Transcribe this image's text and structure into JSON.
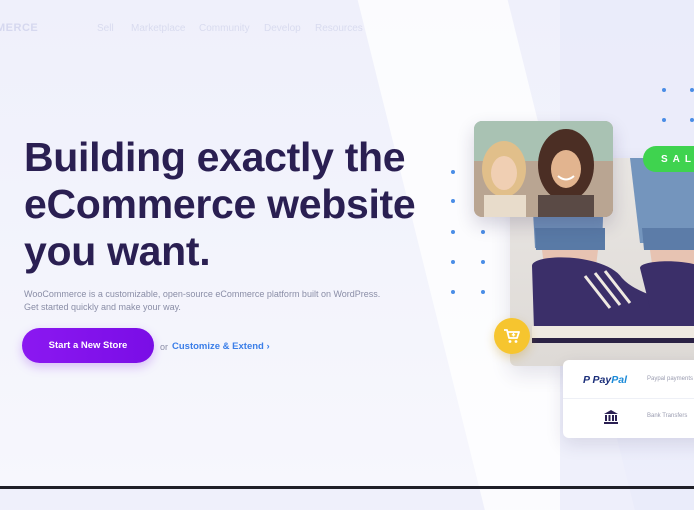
{
  "nav": {
    "logo": "MERCE",
    "links": [
      "Sell",
      "Marketplace",
      "Community",
      "Develop",
      "Resources"
    ]
  },
  "hero": {
    "headline_lines": [
      "Building exactly the",
      "eCommerce website",
      "you want."
    ],
    "subtext_lines": [
      "WooCommerce is a customizable, open-source eCommerce platform built on WordPress.",
      "Get started quickly and make your way."
    ],
    "cta_label": "Start a New Store",
    "or_text": "or",
    "secondary_link": "Customize & Extend ›"
  },
  "showcase": {
    "sale_badge": "SALE",
    "payments": [
      {
        "logo_text_1": "P",
        "logo_text_2": "Pay",
        "logo_text_3": "Pal",
        "label": "Paypal payments"
      },
      {
        "icon": "bank-icon",
        "label": "Bank Transfers"
      }
    ]
  },
  "colors": {
    "headline": "#2a1f52",
    "cta": "#8b18f1",
    "link": "#3a7ee8",
    "sale": "#3fd34f",
    "cart": "#f6c52f",
    "dots": "#4a8de6"
  }
}
